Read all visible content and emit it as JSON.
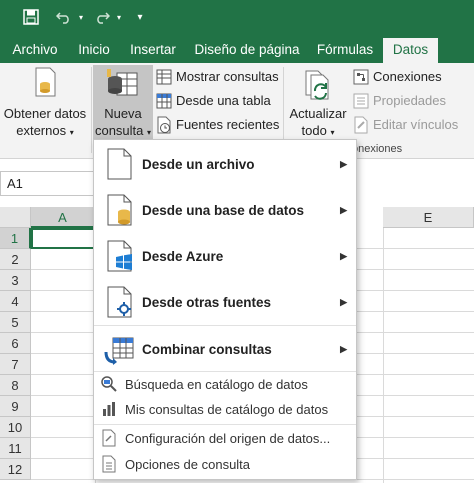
{
  "window": {
    "title_bar_color": "#217346"
  },
  "qat": {
    "save_icon": "save-icon",
    "undo_icon": "undo-icon",
    "redo_icon": "redo-icon",
    "customize_icon": "customize-qat-icon"
  },
  "tabs": [
    "Archivo",
    "Inicio",
    "Insertar",
    "Diseño de página",
    "Fórmulas",
    "Datos"
  ],
  "active_tab": "Datos",
  "ribbon": {
    "obtener_datos": {
      "line1": "Obtener datos",
      "line2": "externos"
    },
    "nueva_consulta": {
      "line1": "Nueva",
      "line2": "consulta"
    },
    "mostrar_consultas": "Mostrar consultas",
    "desde_tabla": "Desde una tabla",
    "fuentes_recientes": "Fuentes recientes",
    "actualizar": {
      "line1": "Actualizar",
      "line2": "todo"
    },
    "conexiones": "Conexiones",
    "propiedades": "Propiedades",
    "editar_vinculos": "Editar vínculos",
    "group_label": "onexiones"
  },
  "namebox": {
    "value": "A1"
  },
  "grid": {
    "columns": [
      "A",
      "E"
    ],
    "rows": [
      "1",
      "2",
      "3",
      "4",
      "5",
      "6",
      "7",
      "8",
      "9",
      "10",
      "11",
      "12"
    ]
  },
  "menu": {
    "desde_archivo": "Desde un archivo",
    "desde_base": "Desde una base de datos",
    "desde_azure": "Desde Azure",
    "desde_otras": "Desde otras fuentes",
    "combinar": "Combinar consultas",
    "busqueda": "Búsqueda en catálogo de datos",
    "mis_consultas": "Mis consultas de catálogo de datos",
    "configuracion": "Configuración del origen de datos...",
    "opciones": "Opciones de consulta"
  }
}
